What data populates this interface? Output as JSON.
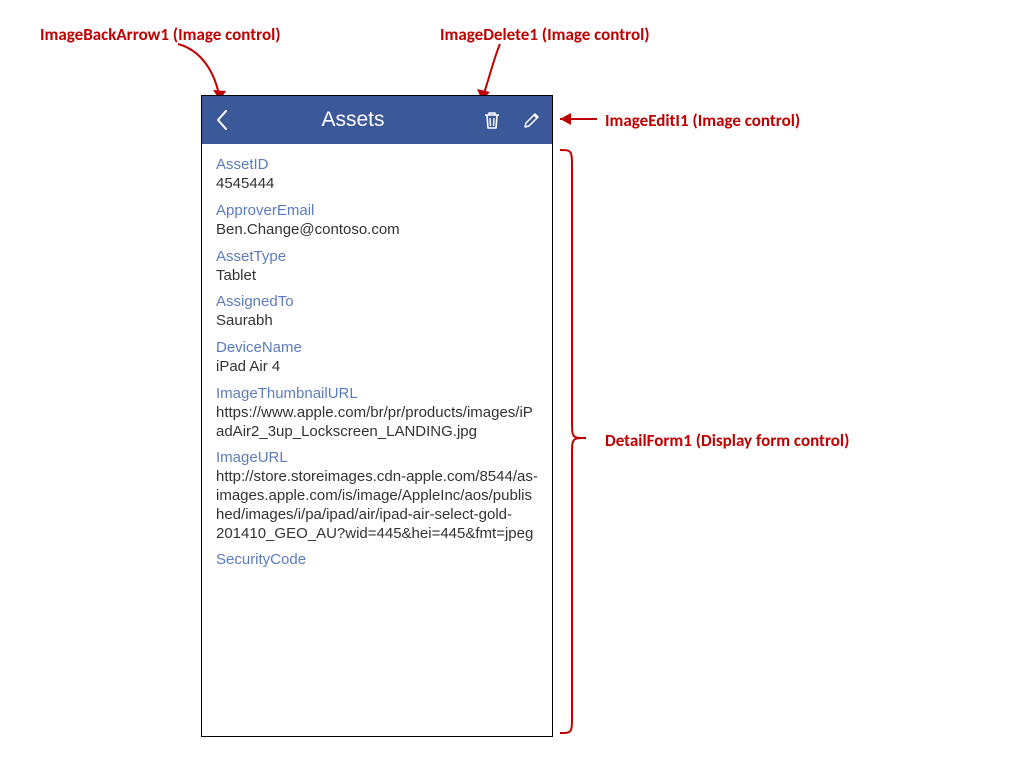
{
  "annotations": {
    "back": "ImageBackArrow1 (Image control)",
    "delete": "ImageDelete1 (Image control)",
    "edit": "ImageEditI1 (Image control)",
    "form": "DetailForm1 (Display form control)"
  },
  "header": {
    "title": "Assets"
  },
  "fields": [
    {
      "label": "AssetID",
      "value": "4545444"
    },
    {
      "label": "ApproverEmail",
      "value": "Ben.Change@contoso.com"
    },
    {
      "label": "AssetType",
      "value": "Tablet"
    },
    {
      "label": "AssignedTo",
      "value": "Saurabh"
    },
    {
      "label": "DeviceName",
      "value": "iPad Air 4"
    },
    {
      "label": "ImageThumbnailURL",
      "value": "https://www.apple.com/br/pr/products/images/iPadAir2_3up_Lockscreen_LANDING.jpg"
    },
    {
      "label": "ImageURL",
      "value": "http://store.storeimages.cdn-apple.com/8544/as-images.apple.com/is/image/AppleInc/aos/published/images/i/pa/ipad/air/ipad-air-select-gold-201410_GEO_AU?wid=445&hei=445&fmt=jpeg"
    },
    {
      "label": "SecurityCode",
      "value": ""
    }
  ],
  "colors": {
    "header_bg": "#3B5998",
    "label_fg": "#5B7CC0",
    "callout": "#C00000"
  }
}
